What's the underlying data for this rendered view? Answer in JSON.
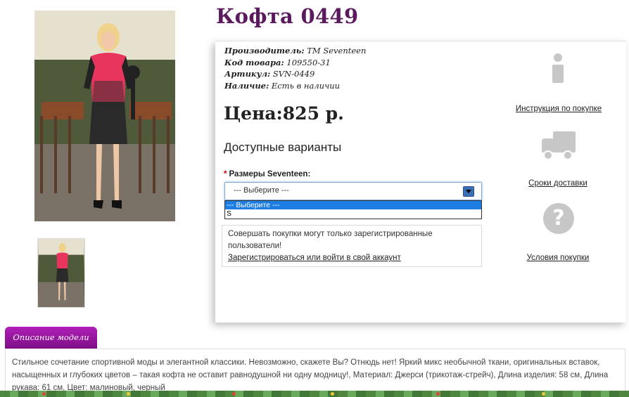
{
  "product": {
    "title": "Кофта 0449",
    "manufacturer_label": "Производитель:",
    "manufacturer_value": "ТМ Seventeen",
    "code_label": "Код товара:",
    "code_value": "109550-31",
    "article_label": "Артикул:",
    "article_value": "SVN-0449",
    "availability_label": "Наличие:",
    "availability_value": "Есть в наличии",
    "price": "Цена:825 р."
  },
  "options": {
    "heading": "Доступные варианты",
    "required_mark": "*",
    "size_label": "Размеры Seventeen:",
    "select_value": "--- Выберите ---",
    "dropdown_items": [
      "--- Выберите ---",
      "S"
    ]
  },
  "notice": {
    "text": "Совершать покупки могут только зарегистрированные пользователи!",
    "link": "Зарегистрироваться или войти в свой аккаунт"
  },
  "side_links": {
    "instructions": "Инструкция по покупке",
    "delivery": "Сроки доставки",
    "terms": "Условия покупки"
  },
  "icons": {
    "info": "info-icon",
    "truck": "truck-icon",
    "help": "question-icon"
  },
  "description": {
    "tab_label": "Описание модели",
    "text": "Стильное сочетание спортивной моды и элегантной классики. Невозможно, скажете Вы? Отнюдь нет! Яркий микс необычной ткани, оригинальных вставок, насыщенных и глубоких цветов – такая кофта не оставит равнодушной ни одну модницу!, Материал: Джерси (трикотаж-стрейч), Длина изделия: 58 см, Длина рукава: 61 см, Цвет: малиновый, черный"
  },
  "colors": {
    "title": "#5b1a5e",
    "tab": "#a01aa8",
    "select_highlight": "#1e7de3"
  }
}
